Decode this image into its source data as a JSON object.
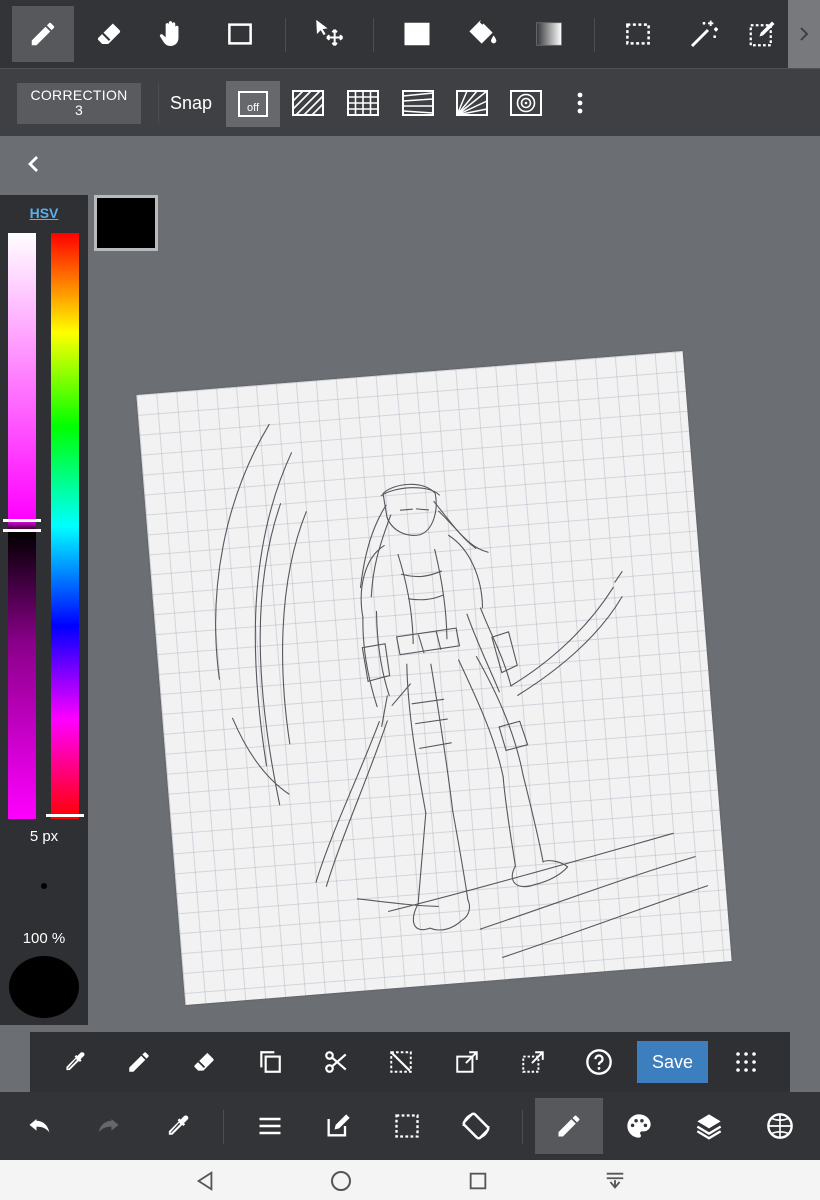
{
  "top_toolbar": {
    "tools": [
      "pencil-icon",
      "eraser-icon",
      "hand-icon",
      "rectangle-icon",
      "move-icon",
      "fill-rect-icon",
      "bucket-icon",
      "gradient-icon",
      "selection-icon",
      "magic-wand-icon",
      "edit-selection-icon"
    ],
    "active_tool": "pencil-icon"
  },
  "sub_toolbar": {
    "correction_label": "CORRECTION",
    "correction_value": "3",
    "snap_label": "Snap",
    "snap_off_label": "off"
  },
  "color_panel": {
    "mode_label": "HSV",
    "brush_size": "5 px",
    "opacity": "100 %",
    "current_color": "#000000"
  },
  "action_bar": {
    "save_label": "Save"
  }
}
